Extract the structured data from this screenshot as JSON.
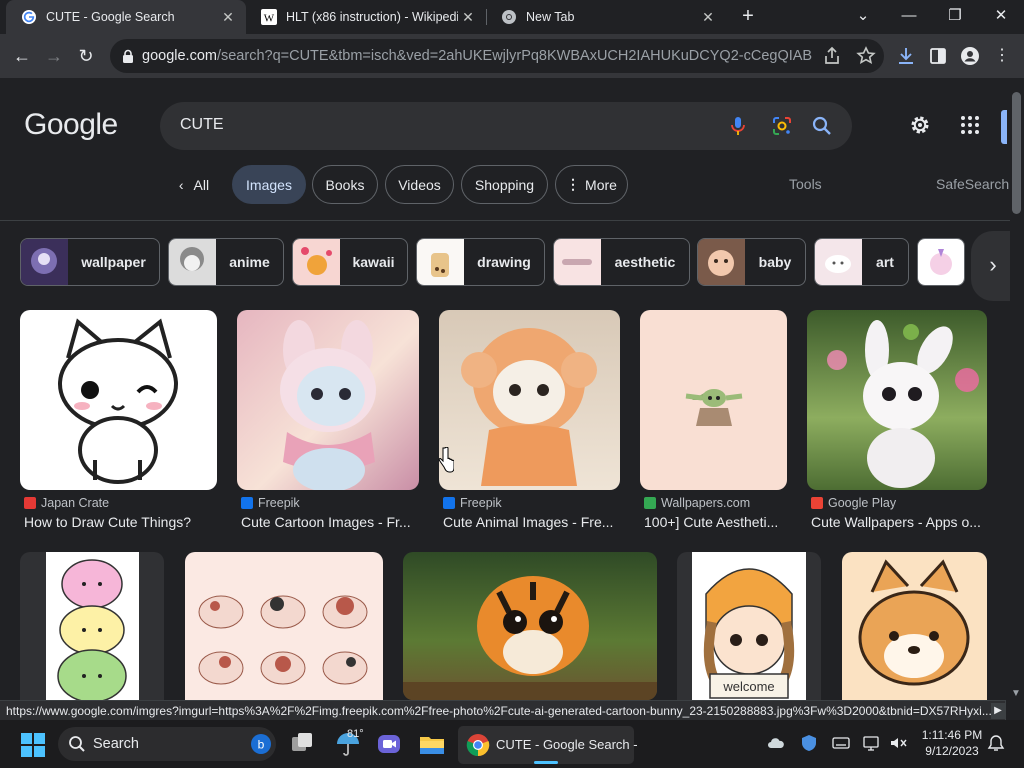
{
  "browser": {
    "tabs": [
      {
        "title": "CUTE - Google Search",
        "active": true
      },
      {
        "title": "HLT (x86 instruction) - Wikipedia",
        "active": false
      },
      {
        "title": "New Tab",
        "active": false
      }
    ],
    "new_tab_label": "+",
    "address": {
      "host": "google.com",
      "path": "/search?q=CUTE&tbm=isch&ved=2ahUKEwjlyrPq8KWBAxUCH2IAHUKuDCYQ2-cCegQIABAA&..."
    }
  },
  "google": {
    "logo_text": "Google",
    "query": "CUTE",
    "nav": {
      "all": "All",
      "images": "Images",
      "books": "Books",
      "videos": "Videos",
      "shopping": "Shopping",
      "more": "More",
      "tools": "Tools",
      "safesearch": "SafeSearch"
    },
    "related": [
      {
        "label": "wallpaper",
        "color": "#4a3b66"
      },
      {
        "label": "anime",
        "color": "#c9c9c9"
      },
      {
        "label": "kawaii",
        "color": "#f3c9c4"
      },
      {
        "label": "drawing",
        "color": "#f4f1ee"
      },
      {
        "label": "aesthetic",
        "color": "#f7dede"
      },
      {
        "label": "baby",
        "color": "#b98e7a"
      },
      {
        "label": "art",
        "color": "#f1e1e6"
      }
    ],
    "results_row1": [
      {
        "source": "Japan Crate",
        "title": "How to Draw Cute Things?",
        "src_color": "#e53935"
      },
      {
        "source": "Freepik",
        "title": "Cute Cartoon Images - Fr...",
        "src_color": "#1273eb"
      },
      {
        "source": "Freepik",
        "title": "Cute Animal Images - Fre...",
        "src_color": "#1273eb"
      },
      {
        "source": "Wallpapers.com",
        "title": "100+] Cute Aestheti...",
        "src_color": "#34a853"
      },
      {
        "source": "Google Play",
        "title": "Cute Wallpapers - Apps o...",
        "src_color": "#ea4335"
      }
    ],
    "results_row2_sign": "welcome"
  },
  "status_url": "https://www.google.com/imgres?imgurl=https%3A%2F%2Fimg.freepik.com%2Ffree-photo%2Fcute-ai-generated-cartoon-bunny_23-2150288883.jpg%3Fw%3D2000&tbnid=DX57RHyxi...",
  "taskbar": {
    "search_label": "Search",
    "weather_temp": "81°",
    "chrome_window_label": "CUTE - Google Search -",
    "time": "1:11:46 PM",
    "date": "9/12/2023"
  },
  "colors": {
    "accent_blue": "#8ab4f8",
    "chip_selected": "#394457",
    "page_bg": "#202124"
  }
}
